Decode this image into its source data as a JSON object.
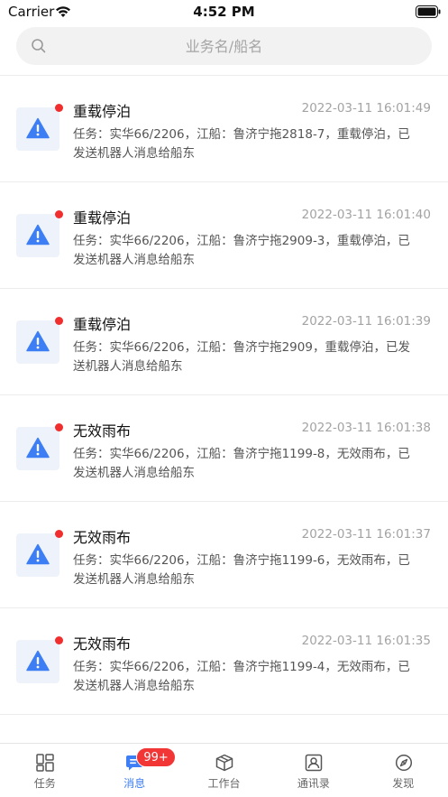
{
  "status_bar": {
    "carrier": "Carrier",
    "time": "4:52 PM"
  },
  "search": {
    "placeholder": "业务名/船名"
  },
  "messages": [
    {
      "title": "重载停泊",
      "time": "2022-03-11 16:01:49",
      "body": "任务：实华66/2206，江船：鲁济宁拖2818-7，重载停泊，已发送机器人消息给船东"
    },
    {
      "title": "重载停泊",
      "time": "2022-03-11 16:01:40",
      "body": "任务：实华66/2206，江船：鲁济宁拖2909-3，重载停泊，已发送机器人消息给船东"
    },
    {
      "title": "重载停泊",
      "time": "2022-03-11 16:01:39",
      "body": "任务：实华66/2206，江船：鲁济宁拖2909，重载停泊，已发送机器人消息给船东"
    },
    {
      "title": "无效雨布",
      "time": "2022-03-11 16:01:38",
      "body": "任务：实华66/2206，江船：鲁济宁拖1199-8，无效雨布，已发送机器人消息给船东"
    },
    {
      "title": "无效雨布",
      "time": "2022-03-11 16:01:37",
      "body": "任务：实华66/2206，江船：鲁济宁拖1199-6，无效雨布，已发送机器人消息给船东"
    },
    {
      "title": "无效雨布",
      "time": "2022-03-11 16:01:35",
      "body": "任务：实华66/2206，江船：鲁济宁拖1199-4，无效雨布，已发送机器人消息给船东"
    }
  ],
  "tabbar": {
    "tabs": [
      {
        "label": "任务",
        "icon": "grid-icon"
      },
      {
        "label": "消息",
        "icon": "chat-icon",
        "badge": "99+"
      },
      {
        "label": "工作台",
        "icon": "cube-icon"
      },
      {
        "label": "通讯录",
        "icon": "contact-card-icon"
      },
      {
        "label": "发现",
        "icon": "compass-icon"
      }
    ],
    "active_index": 1
  },
  "colors": {
    "accent": "#3d7ef5",
    "badge": "#f23535",
    "unread_dot": "#f02e2e",
    "warning_icon": "#3d7ef5"
  }
}
